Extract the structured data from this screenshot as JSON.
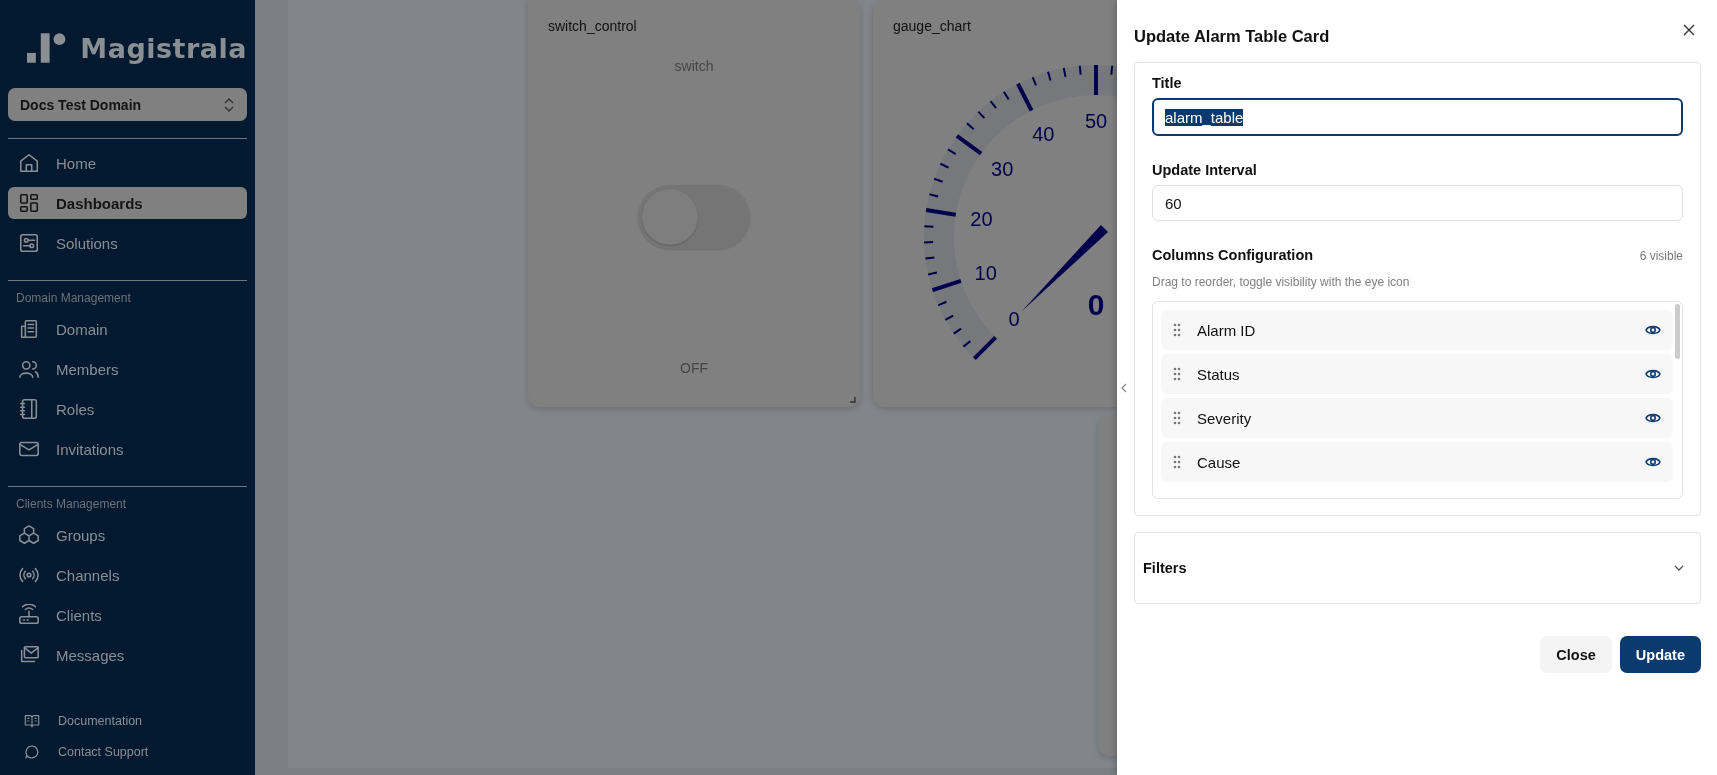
{
  "sidebar": {
    "brand": "Magistrala",
    "domain_selector": "Docs Test Domain",
    "sections": [
      {
        "items": [
          {
            "label": "Home",
            "selected": false
          },
          {
            "label": "Dashboards",
            "selected": true
          },
          {
            "label": "Solutions",
            "selected": false
          }
        ]
      },
      {
        "heading": "Domain Management",
        "items": [
          {
            "label": "Domain",
            "selected": false
          },
          {
            "label": "Members",
            "selected": false
          },
          {
            "label": "Roles",
            "selected": false
          },
          {
            "label": "Invitations",
            "selected": false
          }
        ]
      },
      {
        "heading": "Clients Management",
        "items": [
          {
            "label": "Groups",
            "selected": false
          },
          {
            "label": "Channels",
            "selected": false
          },
          {
            "label": "Clients",
            "selected": false
          },
          {
            "label": "Messages",
            "selected": false
          }
        ]
      }
    ],
    "footer_links": [
      "Documentation",
      "Contact Support"
    ]
  },
  "cards": [
    {
      "kind": "switch",
      "title": "switch_control",
      "label": "switch",
      "on": false,
      "state_text": "OFF"
    },
    {
      "kind": "gauge",
      "title": "gauge_chart",
      "tick_labels": [
        "0",
        "10",
        "20",
        "30",
        "40",
        "50"
      ],
      "value": "0"
    }
  ],
  "drawer": {
    "title": "Update Alarm Table Card",
    "fields": [
      {
        "label": "Title",
        "value": "alarm_table",
        "text_selected": true
      },
      {
        "label": "Update Interval",
        "value": "60",
        "text_selected": false
      }
    ],
    "columns": {
      "heading": "Columns Configuration",
      "count": "6 visible",
      "hint": "Drag to reorder, toggle visibility with the eye icon",
      "items": [
        {
          "label": "Alarm ID",
          "visible": true
        },
        {
          "label": "Status",
          "visible": true
        },
        {
          "label": "Severity",
          "visible": true
        },
        {
          "label": "Cause",
          "visible": true
        }
      ]
    },
    "filters": {
      "label": "Filters",
      "expanded": false
    },
    "buttons": [
      {
        "label": "Close",
        "kind": "secondary"
      },
      {
        "label": "Update",
        "kind": "primary"
      }
    ]
  }
}
